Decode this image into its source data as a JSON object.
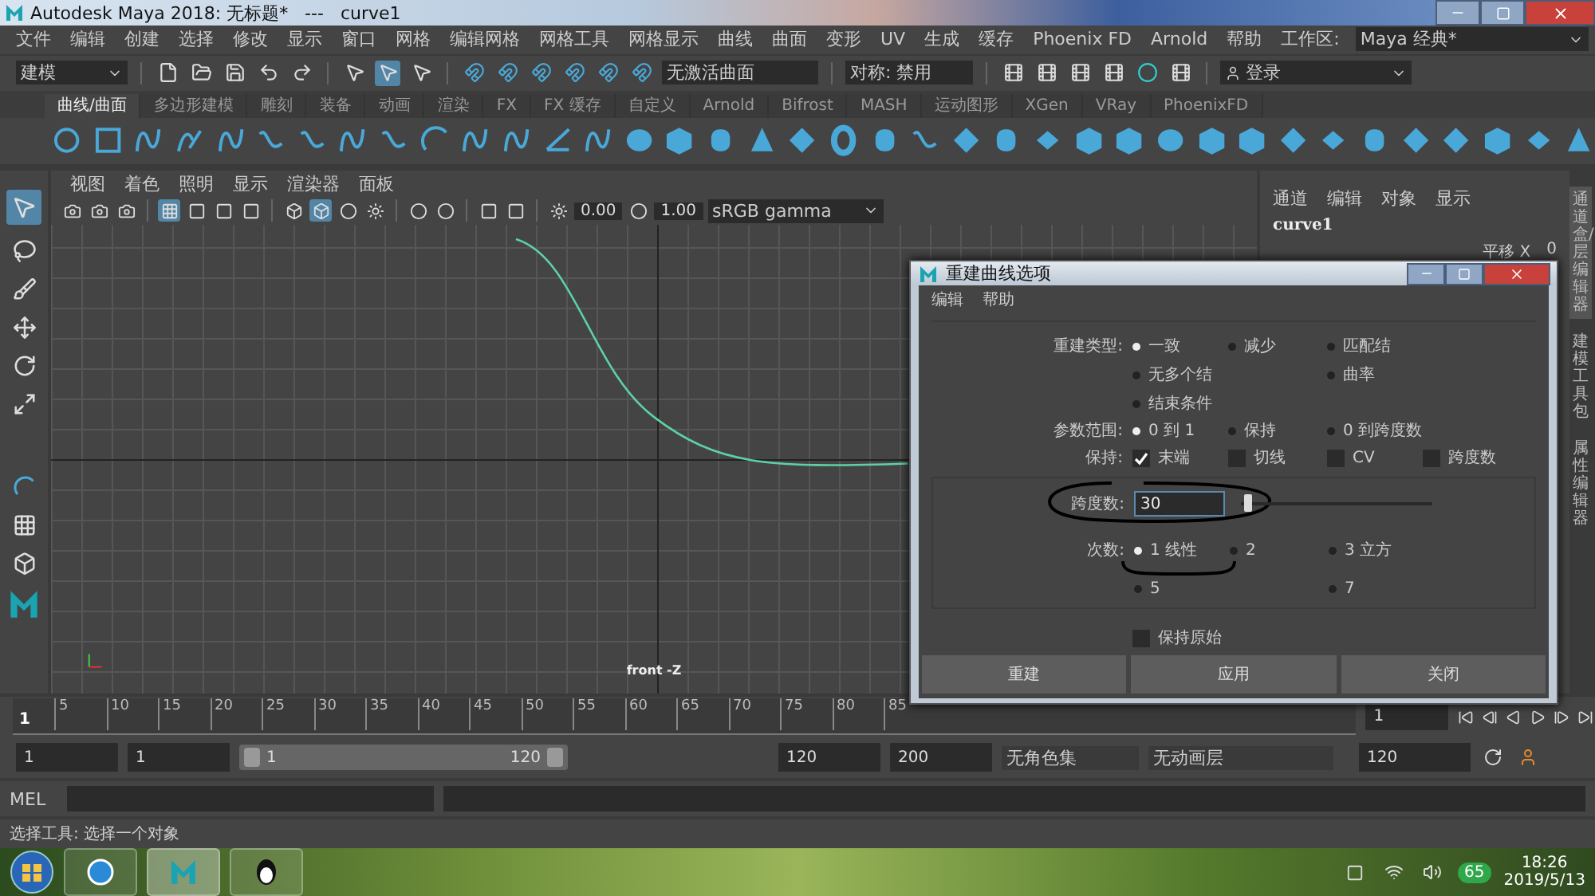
{
  "window": {
    "title": "Autodesk Maya 2018: 无标题*   ---   curve1"
  },
  "menu": [
    "文件",
    "编辑",
    "创建",
    "选择",
    "修改",
    "显示",
    "窗口",
    "网格",
    "编辑网格",
    "网格工具",
    "网格显示",
    "曲线",
    "曲面",
    "变形",
    "UV",
    "生成",
    "缓存",
    "Phoenix FD",
    "Arnold",
    "帮助"
  ],
  "workspace": {
    "label": "工作区:",
    "value": "Maya 经典*"
  },
  "status_line": {
    "mode": "建模",
    "surface_field": "无激活曲面",
    "symmetry": "对称: 禁用",
    "login": "登录"
  },
  "shelf": {
    "tabs": [
      {
        "label": "曲线/曲面",
        "selected": true
      },
      {
        "label": "多边形建模",
        "selected": false
      },
      {
        "label": "雕刻",
        "selected": false
      },
      {
        "label": "装备",
        "selected": false
      },
      {
        "label": "动画",
        "selected": false
      },
      {
        "label": "渲染",
        "selected": false
      },
      {
        "label": "FX",
        "selected": false
      },
      {
        "label": "FX 缓存",
        "selected": false
      },
      {
        "label": "自定义",
        "selected": false
      },
      {
        "label": "Arnold",
        "selected": false
      },
      {
        "label": "Bifrost",
        "selected": false
      },
      {
        "label": "MASH",
        "selected": false
      },
      {
        "label": "运动图形",
        "selected": false
      },
      {
        "label": "XGen",
        "selected": false
      },
      {
        "label": "VRay",
        "selected": false
      },
      {
        "label": "PhoenixFD",
        "selected": false
      }
    ]
  },
  "viewport": {
    "menu": [
      "视图",
      "着色",
      "照明",
      "显示",
      "渲染器",
      "面板"
    ],
    "exposure": "0.00",
    "gamma": "1.00",
    "color_space": "sRGB gamma",
    "camera_label": "front -Z"
  },
  "channel_box": {
    "menu": [
      "通道",
      "编辑",
      "对象",
      "显示"
    ],
    "object": "curve1",
    "channel": "平移 X",
    "channel_value": "0",
    "side_tabs": [
      {
        "label": "通道盒/层编辑器",
        "selected": true
      },
      {
        "label": "建模工具包",
        "selected": false
      },
      {
        "label": "属性编辑器",
        "selected": false
      }
    ]
  },
  "dialog": {
    "title": "重建曲线选项",
    "menu": [
      "编辑",
      "帮助"
    ],
    "rebuild_type": {
      "label": "重建类型:",
      "options": [
        {
          "label": "一致",
          "selected": true
        },
        {
          "label": "减少",
          "selected": false
        },
        {
          "label": "匹配结",
          "selected": false
        },
        {
          "label": "无多个结",
          "selected": false
        },
        {
          "label": "曲率",
          "selected": false
        },
        {
          "label": "结束条件",
          "selected": false
        }
      ]
    },
    "parameter_range": {
      "label": "参数范围:",
      "options": [
        {
          "label": "0 到 1",
          "selected": true
        },
        {
          "label": "保持",
          "selected": false
        },
        {
          "label": "0 到跨度数",
          "selected": false
        }
      ]
    },
    "keep": {
      "label": "保持:",
      "options": [
        {
          "label": "末端",
          "checked": true
        },
        {
          "label": "切线",
          "checked": false
        },
        {
          "label": "CV",
          "checked": false
        },
        {
          "label": "跨度数",
          "checked": false
        }
      ]
    },
    "span_count": {
      "label": "跨度数:",
      "value": "30",
      "level": 0.03
    },
    "degree": {
      "label": "次数:",
      "options": [
        {
          "label": "1 线性",
          "selected": true
        },
        {
          "label": "2",
          "selected": false
        },
        {
          "label": "3 立方",
          "selected": false
        },
        {
          "label": "5",
          "selected": false
        },
        {
          "label": "7",
          "selected": false
        }
      ]
    },
    "keep_original": {
      "label": "保持原始",
      "checked": false
    },
    "buttons": [
      "重建",
      "应用",
      "关闭"
    ]
  },
  "timeline": {
    "current": "1",
    "ticks": [
      "5",
      "10",
      "15",
      "20",
      "25",
      "30",
      "35",
      "40",
      "45",
      "50",
      "55",
      "60",
      "65",
      "70",
      "75",
      "80",
      "85"
    ],
    "frame_field": "1"
  },
  "range": {
    "start": "1",
    "anim_start": "1",
    "range_start": "1",
    "range_end": "120",
    "anim_end": "120",
    "end": "200",
    "character_set": "无角色集",
    "anim_layer": "无动画层",
    "end_field": "120"
  },
  "command_line": {
    "language": "MEL"
  },
  "help_line": "选择工具: 选择一个对象",
  "taskbar": {
    "badge": "65",
    "time": "18:26",
    "date": "2019/5/13"
  }
}
